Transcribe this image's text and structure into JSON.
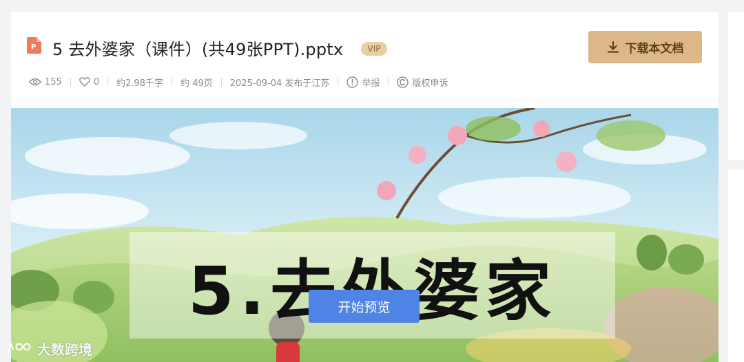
{
  "document": {
    "title": "5 去外婆家（课件）(共49张PPT).pptx",
    "vip_label": "VIP",
    "download_label": "下载本文档"
  },
  "meta": {
    "views": "155",
    "likes": "0",
    "words": "约2.98千字",
    "pages": "约 49页",
    "published": "2025-09-04 发布于江苏",
    "report_label": "举报",
    "copyright_label": "版权申诉"
  },
  "preview": {
    "slide_title": "5.去外婆家",
    "start_preview_label": "开始预览"
  },
  "watermark": {
    "text": "大数跨境"
  },
  "colors": {
    "accent_download": "#dcb888",
    "accent_preview": "#4f83e6",
    "file_icon": "#f07a5c"
  },
  "icons": {
    "file": "ppt-file-icon",
    "download": "download-icon",
    "views": "eye-icon",
    "likes": "heart-icon",
    "report": "exclamation-circle-icon",
    "copyright": "copyright-icon"
  }
}
